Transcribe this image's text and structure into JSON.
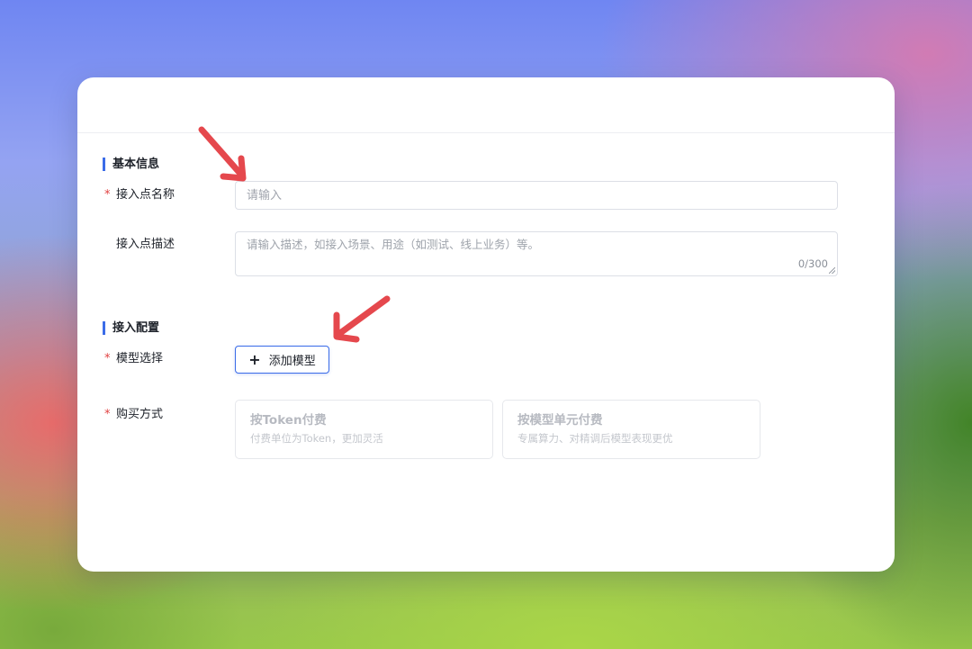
{
  "sections": {
    "basic": {
      "title": "基本信息"
    },
    "config": {
      "title": "接入配置"
    }
  },
  "fields": {
    "name": {
      "label": "接入点名称",
      "required": true,
      "value": "",
      "placeholder": "请输入"
    },
    "description": {
      "label": "接入点描述",
      "required": false,
      "value": "",
      "placeholder": "请输入描述，如接入场景、用途（如测试、线上业务）等。",
      "counter": "0/300"
    },
    "model": {
      "label": "模型选择",
      "required": true,
      "button_icon": "plus-icon",
      "button_label": "添加模型"
    },
    "purchase": {
      "label": "购买方式",
      "required": true,
      "options": [
        {
          "title": "按Token付费",
          "desc": "付费单位为Token，更加灵活"
        },
        {
          "title": "按模型单元付费",
          "desc": "专属算力、对精调后模型表现更优"
        }
      ]
    }
  },
  "colors": {
    "accent": "#3b6ce8",
    "required": "#e14040",
    "annotation_arrow": "#e5484d"
  }
}
